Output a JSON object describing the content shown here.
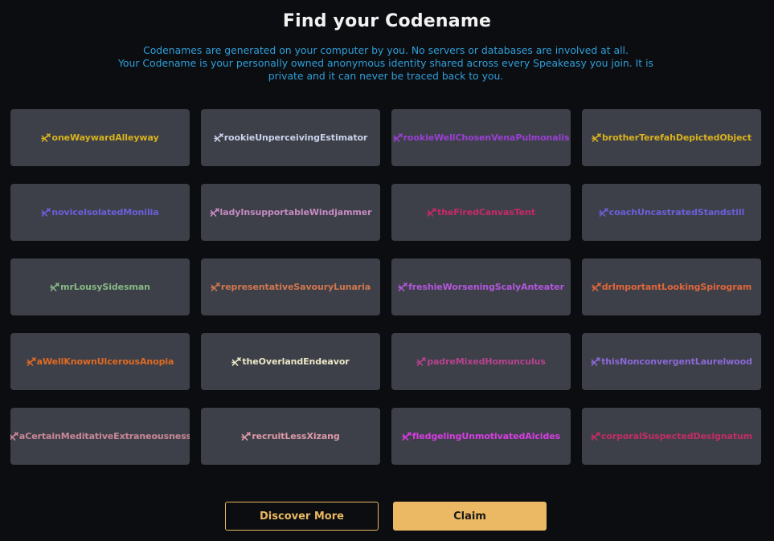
{
  "header": {
    "title": "Find your Codename",
    "description_lines": [
      "Codenames are generated on your computer by you. No servers or databases are involved at all.",
      "Your Codename is your personally owned anonymous identity shared across every Speakeasy you join. It is",
      "private and it can never be traced back to you."
    ]
  },
  "codename_icon": "codename-glyph-icon",
  "codenames": [
    {
      "name": "oneWaywardAlleyway",
      "color": "#d8b21e"
    },
    {
      "name": "rookieUnperceivingEstimator",
      "color": "#c9d3ea"
    },
    {
      "name": "rookieWellChosenVenaPulmonalis",
      "color": "#9a3fd4"
    },
    {
      "name": "brotherTerefahDepictedObject",
      "color": "#d8b21e"
    },
    {
      "name": "noviceIsolatedMonilia",
      "color": "#6b5fd9"
    },
    {
      "name": "ladyInsupportableWindjammer",
      "color": "#c58ac0"
    },
    {
      "name": "theFiredCanvasTent",
      "color": "#c8286a"
    },
    {
      "name": "coachUncastratedStandstill",
      "color": "#6b5fd9"
    },
    {
      "name": "mrLousySidesman",
      "color": "#86b886"
    },
    {
      "name": "representativeSavouryLunaria",
      "color": "#d0774e"
    },
    {
      "name": "freshieWorseningScalyAnteater",
      "color": "#b257dc"
    },
    {
      "name": "drImportantLookingSpirogram",
      "color": "#e0653a"
    },
    {
      "name": "aWellKnownUlcerousAnopia",
      "color": "#e06a22"
    },
    {
      "name": "theOverlandEndeavor",
      "color": "#ece7c6"
    },
    {
      "name": "padreMixedHomunculus",
      "color": "#b6428f"
    },
    {
      "name": "thisNonconvergentLaurelwood",
      "color": "#8b68d8"
    },
    {
      "name": "aCertainMeditativeExtraneousness",
      "color": "#c98797"
    },
    {
      "name": "recruitLessXizang",
      "color": "#dc9aa8"
    },
    {
      "name": "fledgelingUnmotivatedAlcides",
      "color": "#d63ee0"
    },
    {
      "name": "corporalSuspectedDesignatum",
      "color": "#c42c66"
    }
  ],
  "actions": {
    "discover_more": "Discover More",
    "claim": "Claim"
  },
  "colors": {
    "background": "#0c0d11",
    "card": "#3e4049",
    "accent": "#ebb963",
    "description": "#2f9fd8"
  }
}
